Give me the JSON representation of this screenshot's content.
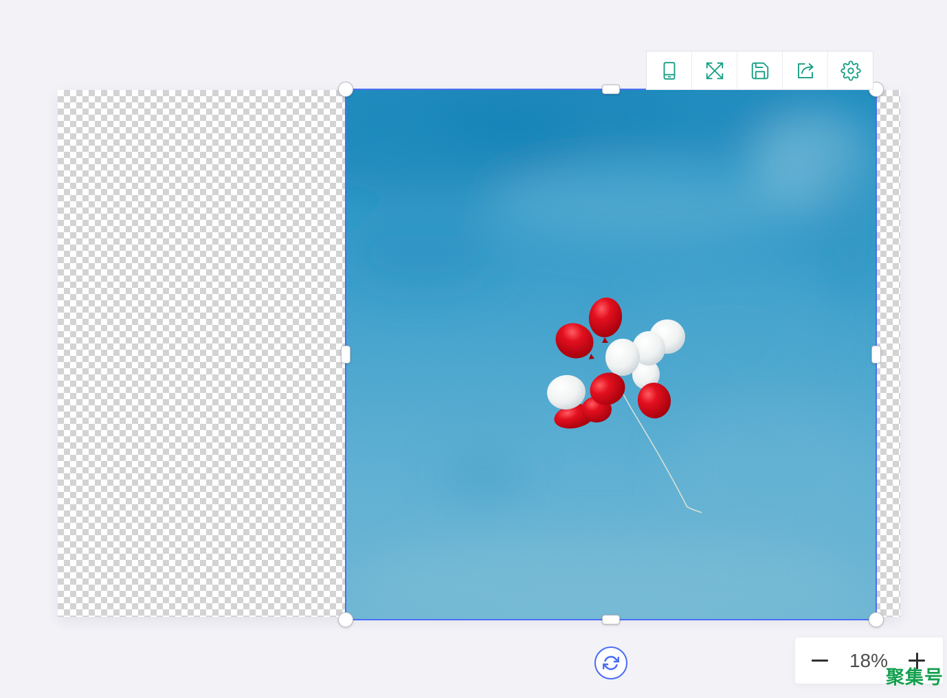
{
  "colors": {
    "workspace_background": "#f3f2f7",
    "selection_accent": "#4c6ef5",
    "toolbar_icon": "#169e84",
    "zoom_text": "#4d4d4d",
    "watermark": "#13a04e"
  },
  "toolbar": {
    "items": [
      {
        "icon": "phone-icon"
      },
      {
        "icon": "fullscreen-icon"
      },
      {
        "icon": "save-icon"
      },
      {
        "icon": "share-icon"
      },
      {
        "icon": "settings-icon"
      }
    ]
  },
  "rotate_button": {
    "icon": "rotate-icon"
  },
  "zoom": {
    "value": "18%",
    "decrease_icon": "minus-icon",
    "increase_icon": "plus-icon"
  },
  "watermark": {
    "text": "聚集号"
  }
}
